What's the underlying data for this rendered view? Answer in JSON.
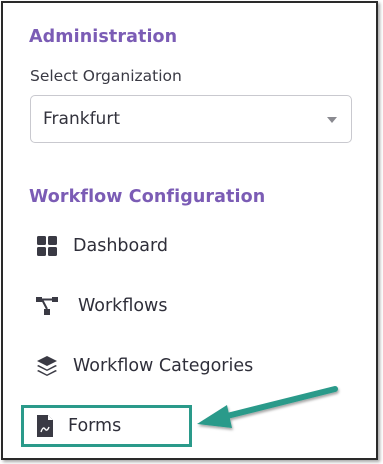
{
  "admin": {
    "title": "Administration",
    "org_label": "Select Organization",
    "org_value": "Frankfurt"
  },
  "workflow": {
    "title": "Workflow Configuration",
    "items": [
      {
        "label": "Dashboard",
        "icon": "grid-icon"
      },
      {
        "label": "Workflows",
        "icon": "workflow-tree-icon"
      },
      {
        "label": "Workflow Categories",
        "icon": "layers-icon"
      },
      {
        "label": "Forms",
        "icon": "document-icon"
      }
    ]
  },
  "colors": {
    "section_title": "#7b5cb5",
    "highlight": "#2a9a8a"
  }
}
